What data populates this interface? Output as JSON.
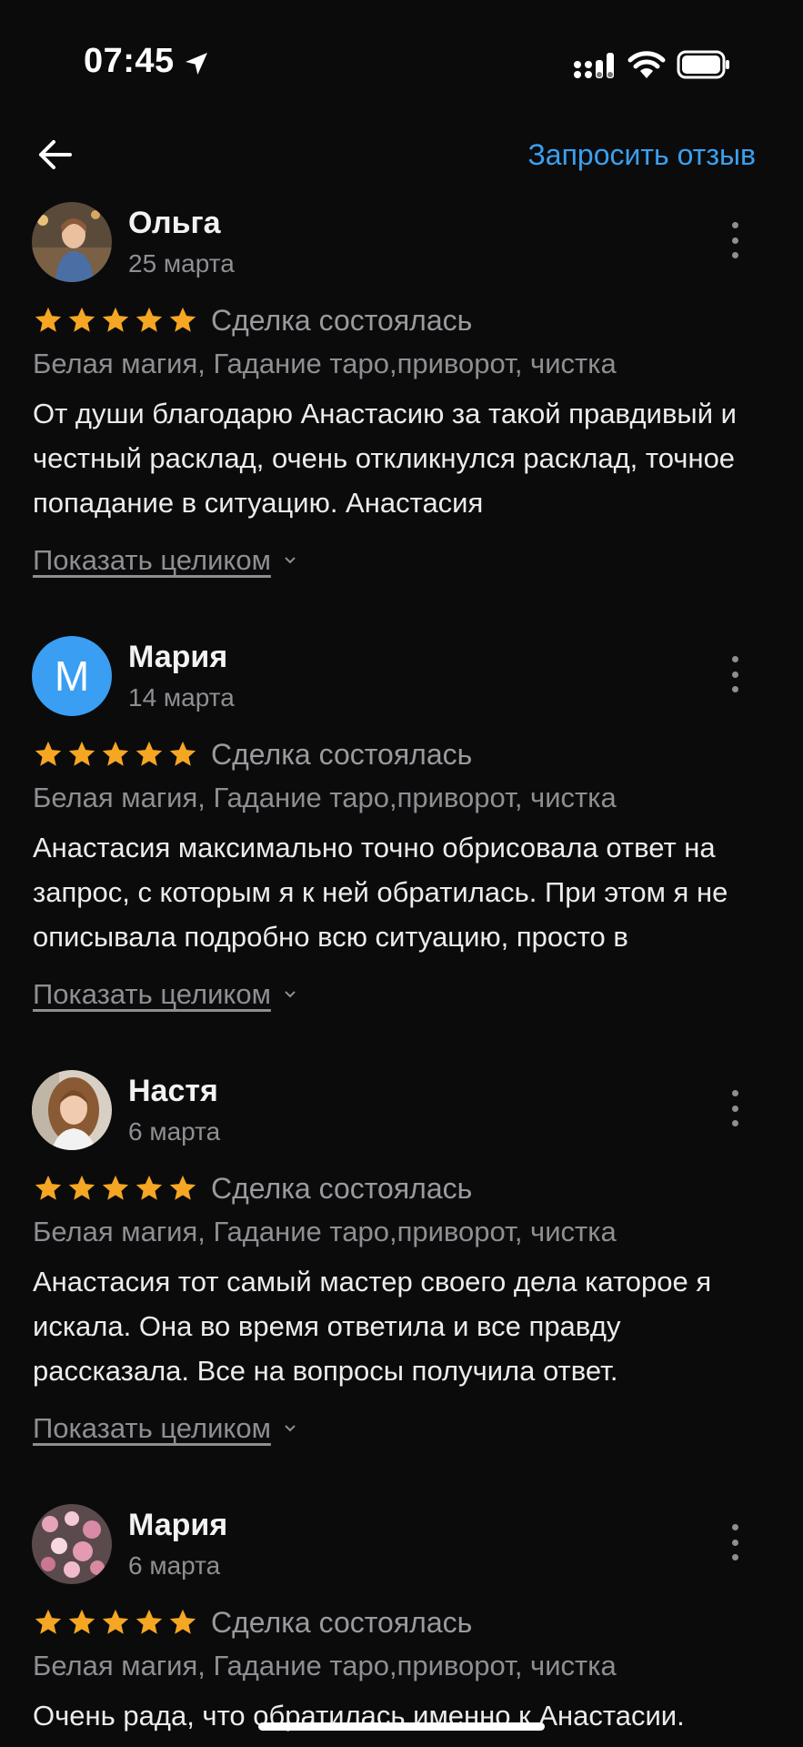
{
  "status_bar": {
    "time": "07:45"
  },
  "nav": {
    "request_review_label": "Запросить отзыв"
  },
  "colors": {
    "accent": "#3aa0ee",
    "star": "#f5a623",
    "background": "#0b0b0c",
    "avatar_letter_bg": "#3a9ef2"
  },
  "reviews": [
    {
      "name": "Ольга",
      "date": "25 марта",
      "rating": 5,
      "deal_status": "Сделка состоялась",
      "categories": "Белая магия, Гадание таро,приворот, чистка",
      "text": "От души благодарю Анастасию за такой правдивый и честный расклад, очень откликнулся расклад, точное попадание в ситуацию. Анастасия",
      "show_more": "Показать целиком"
    },
    {
      "name": "Мария",
      "date": "14 марта",
      "avatar_letter": "М",
      "rating": 5,
      "deal_status": "Сделка состоялась",
      "categories": "Белая магия, Гадание таро,приворот, чистка",
      "text": "Анастасия максимально точно обрисовала ответ на запрос, с которым я к ней обратилась. При этом я не описывала подробно всю ситуацию, просто в",
      "show_more": "Показать целиком"
    },
    {
      "name": "Настя",
      "date": "6 марта",
      "rating": 5,
      "deal_status": "Сделка состоялась",
      "categories": "Белая магия, Гадание таро,приворот, чистка",
      "text": "Анастасия тот самый мастер своего дела каторое я искала. Она во время ответила и все правду рассказала. Все на вопросы получила ответ.",
      "show_more": "Показать целиком"
    },
    {
      "name": "Мария",
      "date": "6 марта",
      "rating": 5,
      "deal_status": "Сделка состоялась",
      "categories": "Белая магия, Гадание таро,приворот, чистка",
      "text": "Очень рада, что обратилась именно к Анастасии."
    }
  ]
}
